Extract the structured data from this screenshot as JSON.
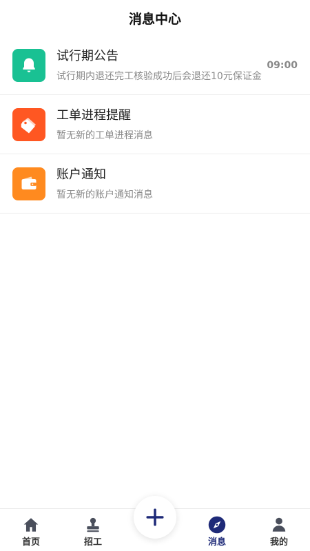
{
  "header": {
    "title": "消息中心"
  },
  "messages": [
    {
      "title": "试行期公告",
      "subtitle": "试行期内退还完工核验成功后会退还10元保证金",
      "time": "09:00",
      "icon": "bell-icon",
      "color": "#19c193"
    },
    {
      "title": "工单进程提醒",
      "subtitle": "暂无新的工单进程消息",
      "time": "",
      "icon": "tags-icon",
      "color": "#ff5722"
    },
    {
      "title": "账户通知",
      "subtitle": "暂无新的账户通知消息",
      "time": "",
      "icon": "wallet-icon",
      "color": "#ff8a1f"
    }
  ],
  "tabbar": {
    "tabs": [
      {
        "label": "首页",
        "icon": "home-icon"
      },
      {
        "label": "招工",
        "icon": "recruit-stamp-icon"
      },
      {
        "label": "消息",
        "icon": "compass-icon",
        "active": true
      },
      {
        "label": "我的",
        "icon": "user-icon"
      }
    ],
    "fab_icon": "plus-icon",
    "active_color": "#1e2a78",
    "icon_color": "#4a4f5c"
  }
}
